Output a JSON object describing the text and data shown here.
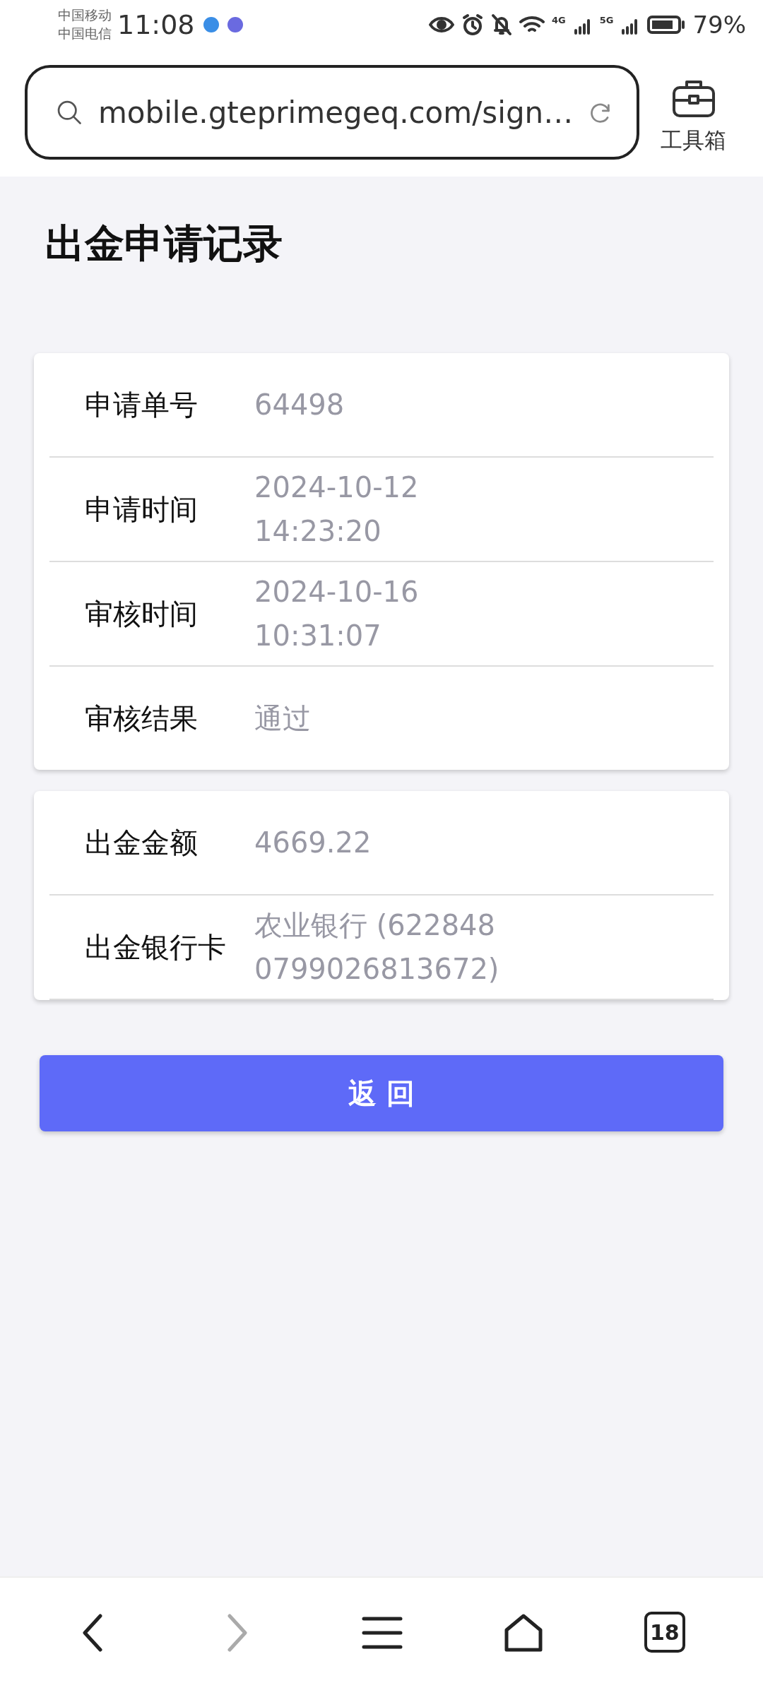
{
  "status_bar": {
    "carriers": [
      "中国移动",
      "中国电信"
    ],
    "time": "11:08",
    "network_labels": [
      "4G",
      "5G"
    ],
    "battery": "79%"
  },
  "address_bar": {
    "url": "mobile.gteprimegeq.com/sign…",
    "tools_label": "工具箱"
  },
  "page": {
    "title": "出金申请记录",
    "cards": [
      {
        "rows": [
          {
            "label": "申请单号",
            "value": "64498"
          },
          {
            "label": "申请时间",
            "value": "2024-10-12 14:23:20"
          },
          {
            "label": "审核时间",
            "value": "2024-10-16 10:31:07"
          },
          {
            "label": "审核结果",
            "value": "通过"
          }
        ]
      },
      {
        "rows": [
          {
            "label": "出金金额",
            "value": "4669.22"
          },
          {
            "label": "出金银行卡",
            "value": "农业银行 (622848 0799026813672)"
          }
        ]
      }
    ],
    "button": "返 回"
  },
  "bottom_nav": {
    "items": [
      {
        "kind": "back",
        "disabled": false
      },
      {
        "kind": "forward",
        "disabled": true
      },
      {
        "kind": "menu",
        "disabled": false
      },
      {
        "kind": "home",
        "disabled": false
      },
      {
        "kind": "tabs",
        "disabled": false,
        "count": "18"
      }
    ]
  }
}
